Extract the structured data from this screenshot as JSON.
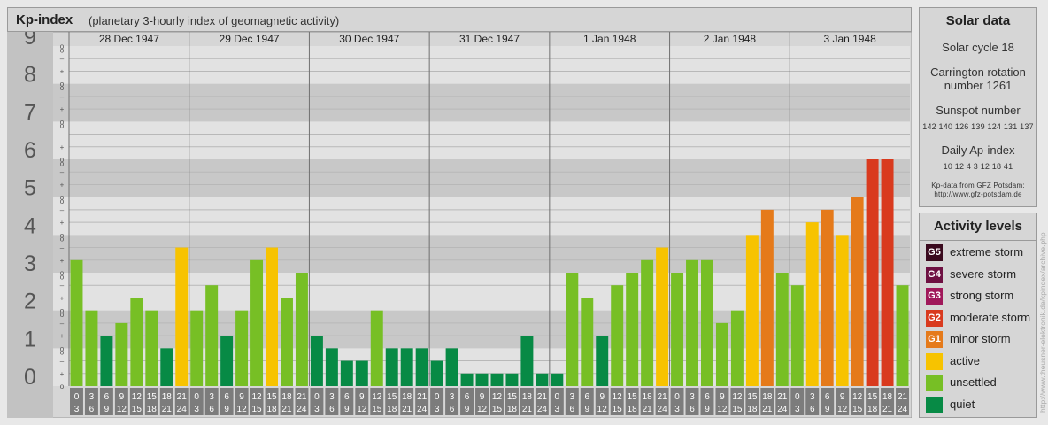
{
  "header": {
    "title": "Kp-index",
    "subtitle": "(planetary 3-hourly index of geomagnetic activity)"
  },
  "chart_data": {
    "type": "bar",
    "ylim": [
      0,
      9
    ],
    "y_major_labels": [
      "0",
      "1",
      "2",
      "3",
      "4",
      "5",
      "6",
      "7",
      "8",
      "9"
    ],
    "y_minor_marks": [
      "o",
      "+",
      "–",
      "o"
    ],
    "days": [
      "28 Dec 1947",
      "29 Dec 1947",
      "30 Dec 1947",
      "31 Dec 1947",
      "1 Jan 1948",
      "2 Jan 1948",
      "3 Jan 1948"
    ],
    "interval_labels": [
      [
        "0",
        "3"
      ],
      [
        "3",
        "6"
      ],
      [
        "6",
        "9"
      ],
      [
        "9",
        "12"
      ],
      [
        "12",
        "15"
      ],
      [
        "15",
        "18"
      ],
      [
        "18",
        "21"
      ],
      [
        "21",
        "24"
      ]
    ],
    "values": [
      3.333,
      2.0,
      1.333,
      1.667,
      2.333,
      2.0,
      1.0,
      3.667,
      2.0,
      2.667,
      1.333,
      2.0,
      3.333,
      3.667,
      2.333,
      3.0,
      1.333,
      1.0,
      0.667,
      0.667,
      2.0,
      1.0,
      1.0,
      1.0,
      0.667,
      1.0,
      0.333,
      0.333,
      0.333,
      0.333,
      1.333,
      0.333,
      0.333,
      3.0,
      2.333,
      1.333,
      2.667,
      3.0,
      3.333,
      3.667,
      3.0,
      3.333,
      3.333,
      1.667,
      2.0,
      4.0,
      4.667,
      3.0,
      2.667,
      4.333,
      4.667,
      4.0,
      5.0,
      6.0,
      6.0,
      2.667
    ]
  },
  "solar": {
    "title": "Solar data",
    "cycle": "Solar cycle 18",
    "carrington_line1": "Carrington rotation",
    "carrington_line2": "number 1261",
    "sunspot_title": "Sunspot number",
    "sunspot_values": "142 140 126 139 124 131 137",
    "ap_title": "Daily Ap-index",
    "ap_values": "10 12 4 3 12 18 41",
    "source_line1": "Kp-data from GFZ Potsdam:",
    "source_line2": "http://www.gfz-potsdam.de"
  },
  "levels": {
    "title": "Activity levels",
    "items": [
      {
        "code": "G5",
        "label": "extreme storm",
        "color": "#3a0a1e"
      },
      {
        "code": "G4",
        "label": "severe storm",
        "color": "#6e1042"
      },
      {
        "code": "G3",
        "label": "strong storm",
        "color": "#a0185a"
      },
      {
        "code": "G2",
        "label": "moderate storm",
        "color": "#d93a1e"
      },
      {
        "code": "G1",
        "label": "minor storm",
        "color": "#e57a1a"
      },
      {
        "code": "",
        "label": "active",
        "color": "#f7c300"
      },
      {
        "code": "",
        "label": "unsettled",
        "color": "#77bf25"
      },
      {
        "code": "",
        "label": "quiet",
        "color": "#078a45"
      }
    ]
  },
  "colors": {
    "quiet": "#078a45",
    "unsettled": "#77bf25",
    "active": "#f7c300",
    "G1": "#e57a1a",
    "G2": "#d93a1e"
  },
  "watermark": "http://www.theusner-elektronik.de/kpindex/archive.php"
}
